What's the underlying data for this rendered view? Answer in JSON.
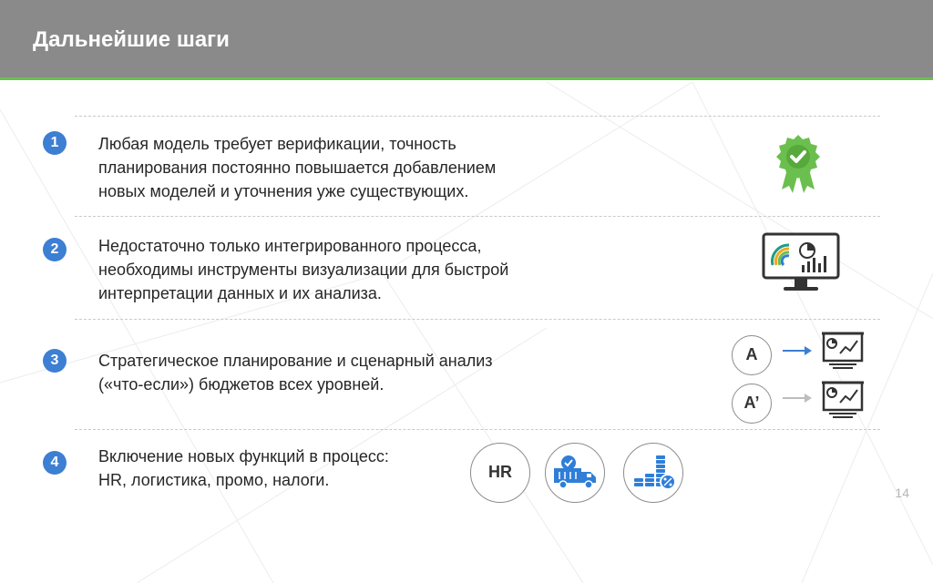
{
  "header": {
    "title": "Дальнейшие шаги"
  },
  "steps": [
    {
      "number": "1",
      "lines": [
        "Любая модель требует верификации, точность",
        "планирования постоянно повышается добавлением",
        "новых моделей и уточнения уже существующих."
      ]
    },
    {
      "number": "2",
      "lines": [
        "Недостаточно только интегрированного процесса,",
        "необходимы инструменты визуализации для быстрой",
        "интерпретации данных и их анализа."
      ]
    },
    {
      "number": "3",
      "lines": [
        "Стратегическое планирование и сценарный анализ",
        "(«что-если») бюджетов всех уровней."
      ]
    },
    {
      "number": "4",
      "lines": [
        "Включение новых функций в процесс:",
        "HR, логистика, промо, налоги."
      ]
    }
  ],
  "scenario": {
    "a_label": "A",
    "a_prime_label": "A’"
  },
  "functions": {
    "hr_label": "HR"
  },
  "colors": {
    "header": "#8a8a8a",
    "accent_green": "#6bbf4e",
    "step_blue": "#3c7fd3",
    "icon_blue": "#2f7ed8"
  },
  "footer": {
    "page_number": "14"
  }
}
